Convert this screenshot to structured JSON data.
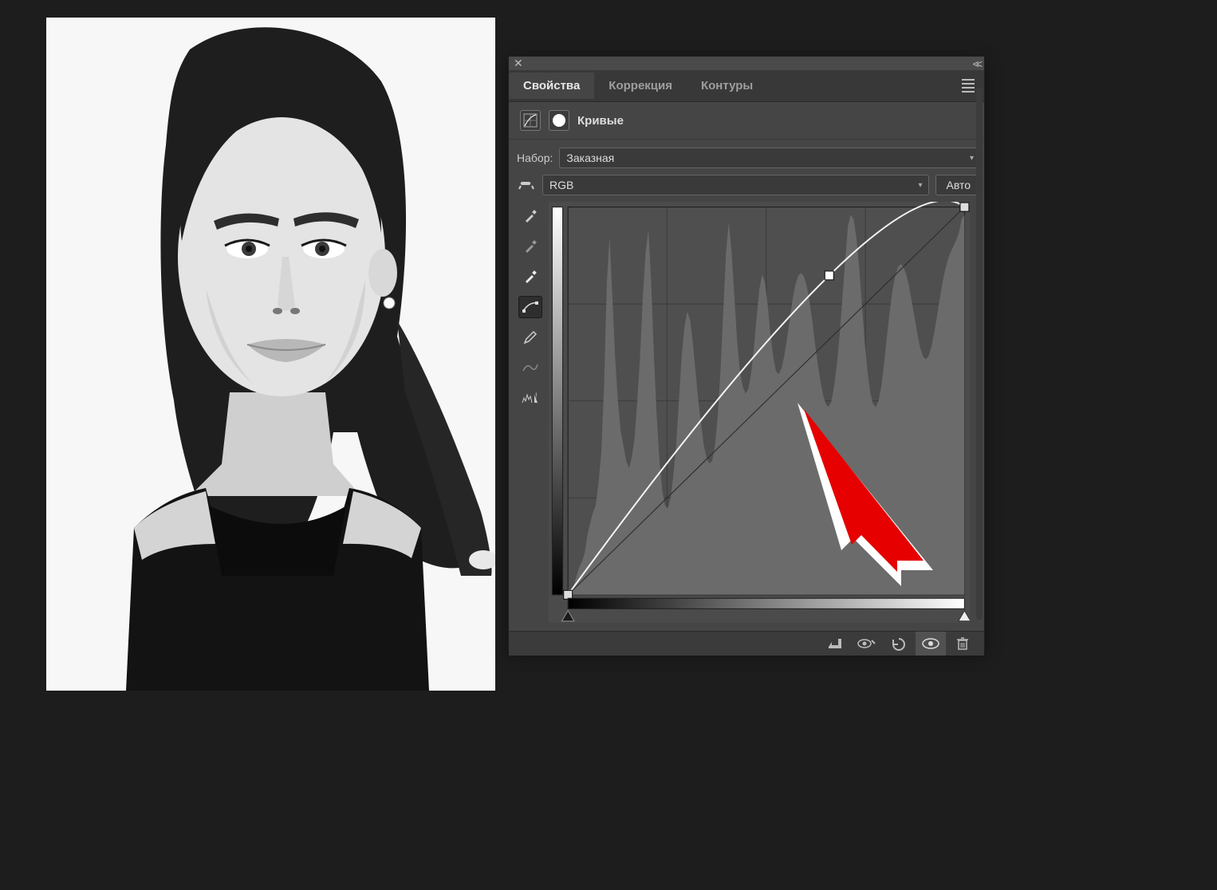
{
  "tabs": {
    "properties": "Свойства",
    "correction": "Коррекция",
    "contours": "Контуры"
  },
  "subheader": {
    "title": "Кривые"
  },
  "preset": {
    "label": "Набор:",
    "value": "Заказная"
  },
  "channel": {
    "value": "RGB",
    "auto": "Авто"
  },
  "curve": {
    "graph_size": 440,
    "points": [
      {
        "in": 0,
        "out": 0
      },
      {
        "in": 168,
        "out": 210
      },
      {
        "in": 255,
        "out": 255
      }
    ],
    "histogram": [
      4,
      3,
      6,
      12,
      18,
      22,
      28,
      40,
      48,
      55,
      60,
      75,
      95,
      140,
      210,
      240,
      200,
      160,
      130,
      110,
      100,
      90,
      85,
      92,
      105,
      130,
      160,
      200,
      230,
      245,
      210,
      160,
      120,
      90,
      70,
      60,
      58,
      65,
      80,
      100,
      130,
      160,
      180,
      190,
      185,
      170,
      150,
      130,
      115,
      100,
      92,
      88,
      90,
      100,
      120,
      150,
      190,
      230,
      250,
      230,
      200,
      170,
      150,
      140,
      135,
      138,
      148,
      165,
      185,
      205,
      215,
      210,
      195,
      175,
      160,
      150,
      148,
      152,
      160,
      172,
      185,
      198,
      208,
      214,
      216,
      214,
      208,
      198,
      185,
      170,
      156,
      144,
      134,
      128,
      126,
      130,
      140,
      155,
      175,
      200,
      225,
      248,
      255,
      252,
      240,
      220,
      195,
      170,
      150,
      136,
      128,
      126,
      130,
      140,
      155,
      173,
      190,
      204,
      214,
      220,
      222,
      220,
      215,
      207,
      197,
      186,
      175,
      166,
      160,
      158,
      160,
      166,
      175,
      186,
      198,
      209,
      218,
      225,
      230,
      234,
      238,
      243,
      252,
      255
    ],
    "slider_black": 0,
    "slider_white": 255
  },
  "footer_icons": {
    "clip": "clip-icon",
    "eye_prev": "compare-icon",
    "reset": "reset-icon",
    "visibility": "visibility-icon",
    "trash": "trash-icon"
  }
}
